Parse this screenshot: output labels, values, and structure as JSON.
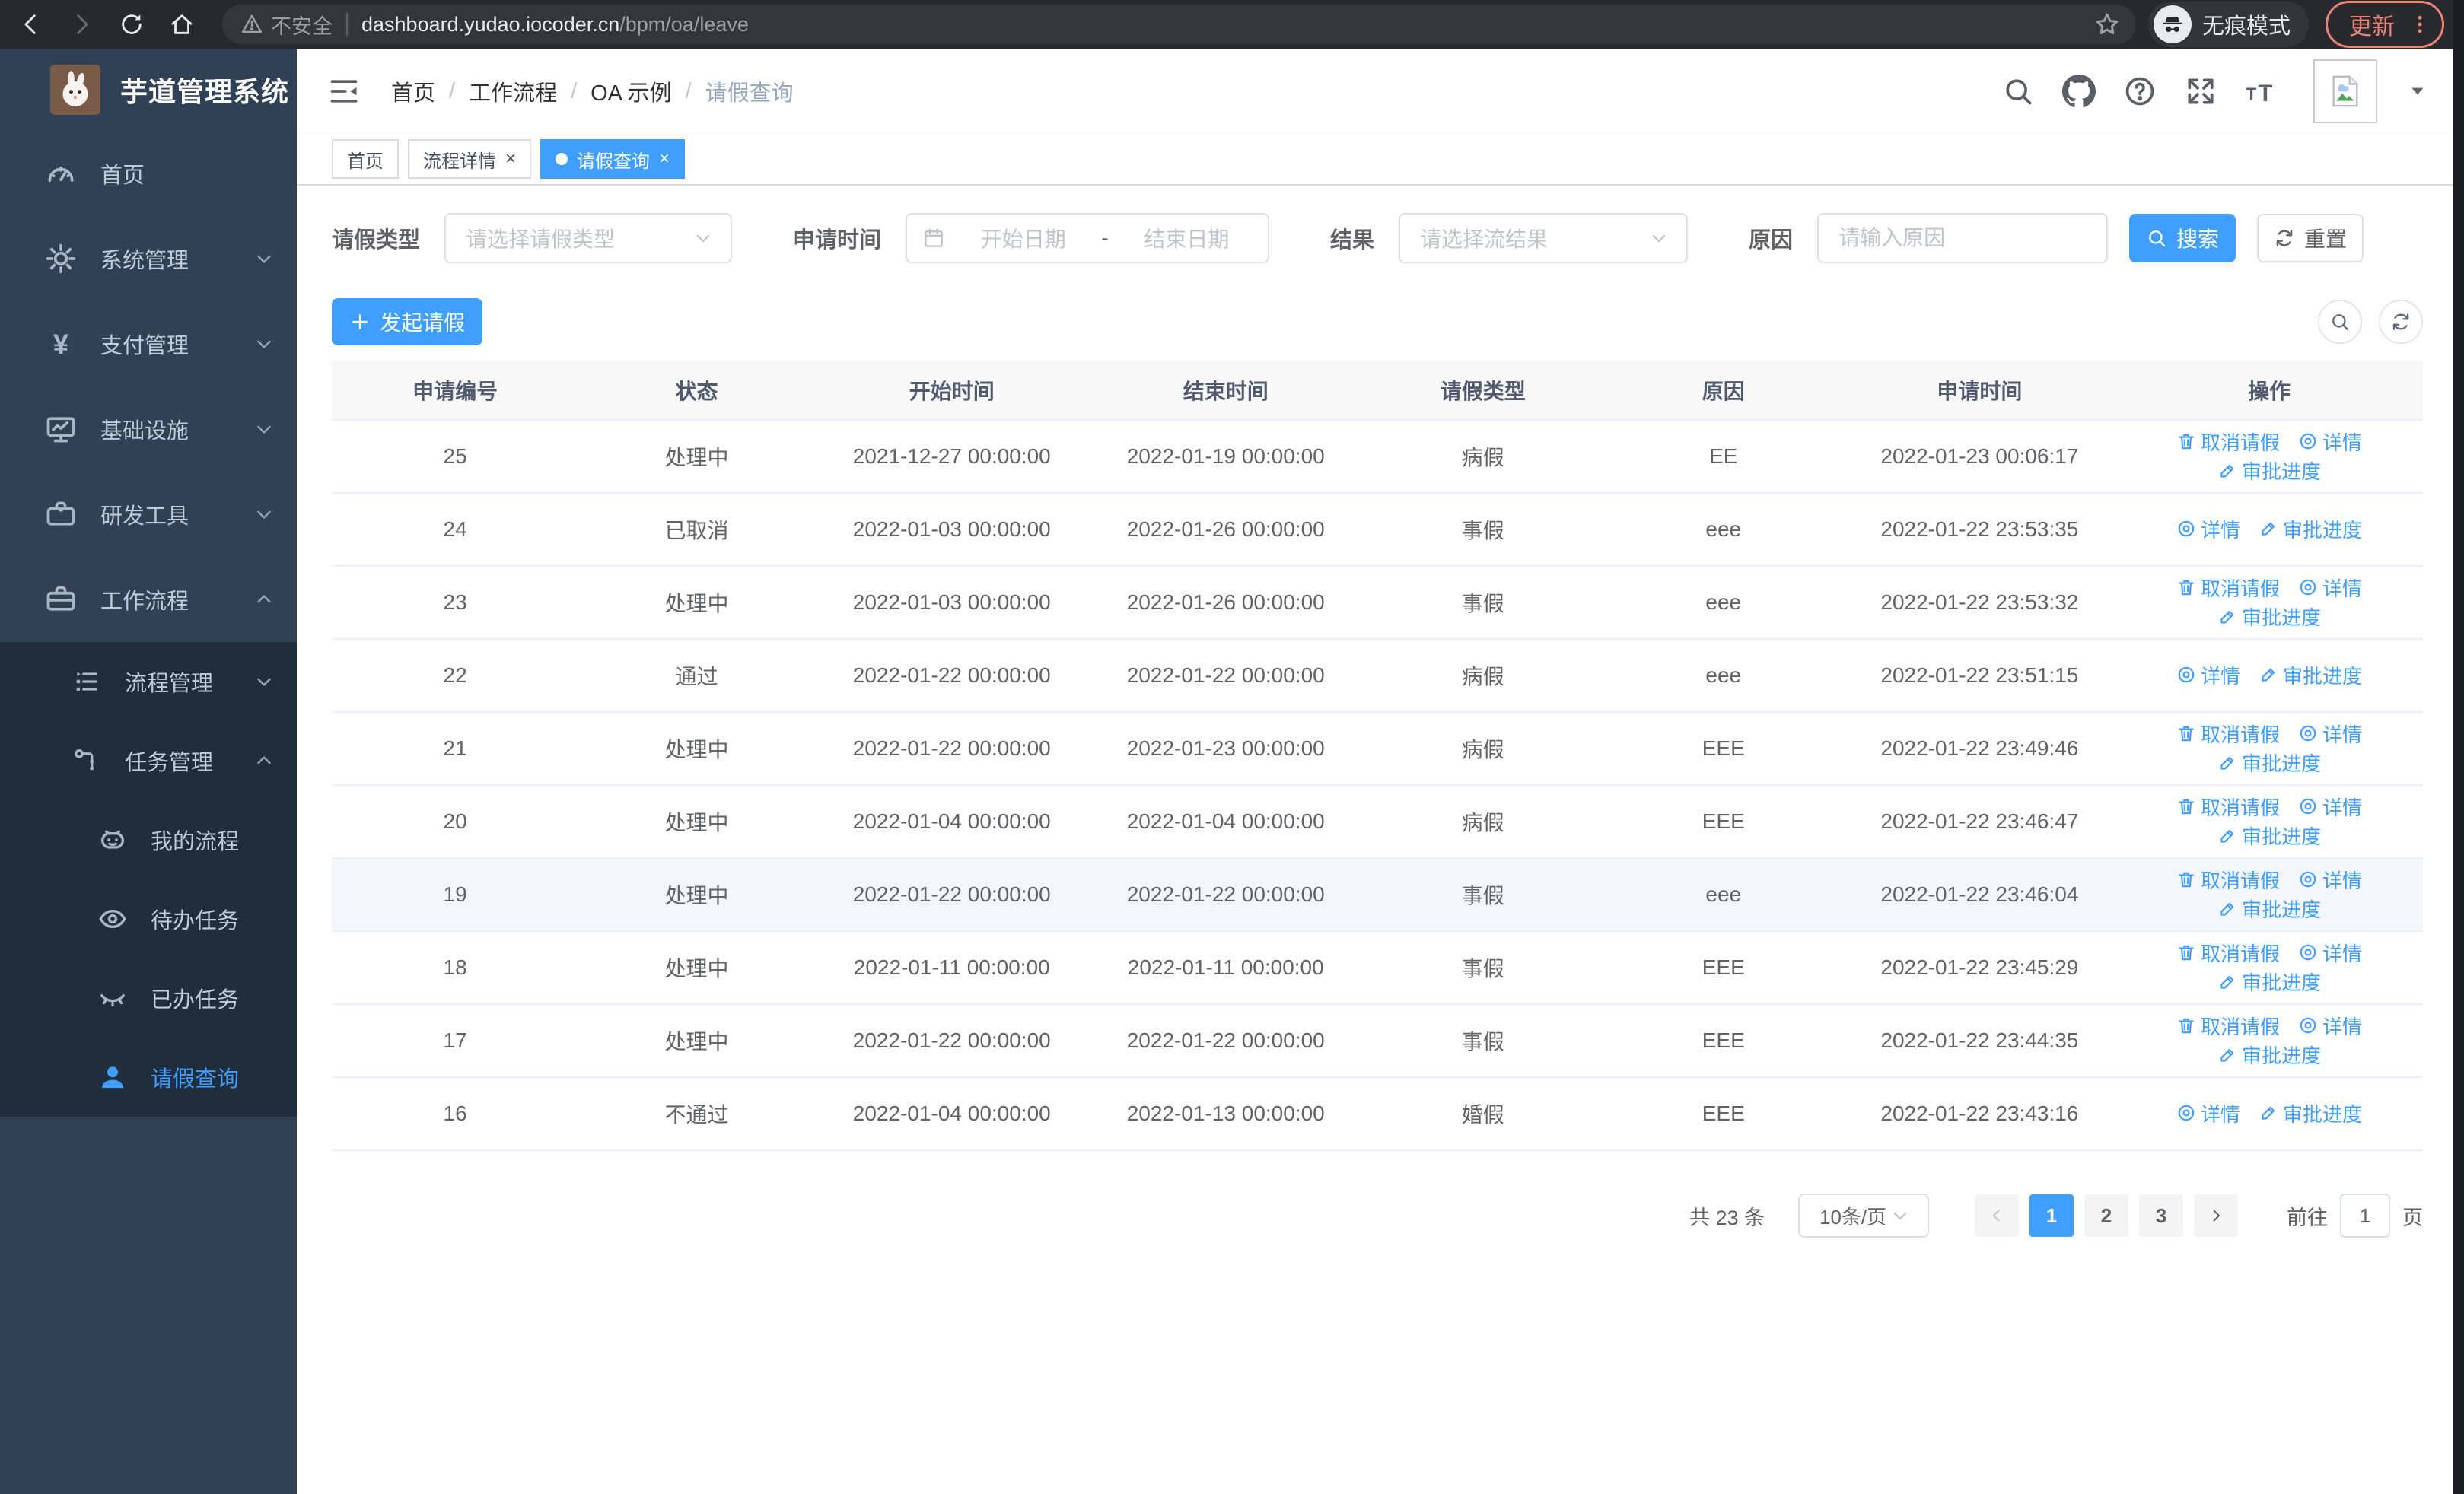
{
  "browser": {
    "nav_icons": [
      "back-icon",
      "forward-icon",
      "reload-icon",
      "home-icon"
    ],
    "security_label": "不安全",
    "url_host": "dashboard.yudao.iocoder.cn",
    "url_path": "/bpm/oa/leave",
    "incognito_label": "无痕模式",
    "update_label": "更新",
    "update_color": "#ee8277"
  },
  "sidebar": {
    "title": "芋道管理系统",
    "menu": [
      {
        "name": "home",
        "label": "首页",
        "icon": "dashboard-icon",
        "level": 0,
        "arrow": null,
        "submenu": false,
        "active": false
      },
      {
        "name": "system",
        "label": "系统管理",
        "icon": "gear-icon",
        "level": 0,
        "arrow": "down",
        "submenu": false,
        "active": false
      },
      {
        "name": "payment",
        "label": "支付管理",
        "icon": "yen-icon",
        "level": 0,
        "arrow": "down",
        "submenu": false,
        "active": false
      },
      {
        "name": "infra",
        "label": "基础设施",
        "icon": "monitor-icon",
        "level": 0,
        "arrow": "down",
        "submenu": false,
        "active": false
      },
      {
        "name": "devtools",
        "label": "研发工具",
        "icon": "toolbox-icon",
        "level": 0,
        "arrow": "down",
        "submenu": false,
        "active": false
      },
      {
        "name": "workflow",
        "label": "工作流程",
        "icon": "briefcase-icon",
        "level": 0,
        "arrow": "up",
        "submenu": false,
        "active": false
      },
      {
        "name": "process-mgmt",
        "label": "流程管理",
        "icon": "list-icon",
        "level": 1,
        "arrow": "down",
        "submenu": true,
        "active": false
      },
      {
        "name": "task-mgmt",
        "label": "任务管理",
        "icon": "sitemap-icon",
        "level": 1,
        "arrow": "up",
        "submenu": true,
        "active": false
      },
      {
        "name": "my-process",
        "label": "我的流程",
        "icon": "robot-icon",
        "level": 2,
        "arrow": null,
        "submenu": true,
        "active": false
      },
      {
        "name": "todo-tasks",
        "label": "待办任务",
        "icon": "eye-icon",
        "level": 2,
        "arrow": null,
        "submenu": true,
        "active": false
      },
      {
        "name": "done-tasks",
        "label": "已办任务",
        "icon": "eye-closed-icon",
        "level": 2,
        "arrow": null,
        "submenu": true,
        "active": false
      },
      {
        "name": "leave-query",
        "label": "请假查询",
        "icon": "user-icon",
        "level": 2,
        "arrow": null,
        "submenu": true,
        "active": true
      }
    ]
  },
  "header": {
    "breadcrumb": [
      {
        "label": "首页",
        "current": false
      },
      {
        "label": "工作流程",
        "current": false
      },
      {
        "label": "OA 示例",
        "current": false
      },
      {
        "label": "请假查询",
        "current": true
      }
    ],
    "tools": [
      "search-icon",
      "github-icon",
      "help-icon",
      "fullscreen-icon",
      "fontsize-icon"
    ],
    "tabs": [
      {
        "name": "home",
        "label": "首页",
        "closable": false,
        "active": false
      },
      {
        "name": "process-detail",
        "label": "流程详情",
        "closable": true,
        "active": false
      },
      {
        "name": "leave-query",
        "label": "请假查询",
        "closable": true,
        "active": true
      }
    ]
  },
  "filters": {
    "leave_type": {
      "label": "请假类型",
      "placeholder": "请选择请假类型"
    },
    "apply_time": {
      "label": "申请时间",
      "start_placeholder": "开始日期",
      "separator": "-",
      "end_placeholder": "结束日期"
    },
    "result": {
      "label": "结果",
      "placeholder": "请选择流结果"
    },
    "reason": {
      "label": "原因",
      "placeholder": "请输入原因"
    },
    "search_label": "搜索",
    "reset_label": "重置"
  },
  "toolbar": {
    "create_label": "发起请假"
  },
  "table": {
    "columns": [
      "申请编号",
      "状态",
      "开始时间",
      "结束时间",
      "请假类型",
      "原因",
      "申请时间",
      "操作"
    ],
    "action_defs": {
      "cancel": {
        "label": "取消请假",
        "icon": "trash-icon"
      },
      "detail": {
        "label": "详情",
        "icon": "view-icon"
      },
      "progress": {
        "label": "审批进度",
        "icon": "edit-icon"
      }
    },
    "rows": [
      {
        "id": "25",
        "status": "处理中",
        "start": "2021-12-27 00:00:00",
        "end": "2022-01-19 00:00:00",
        "type": "病假",
        "reason": "EE",
        "apply_time": "2022-01-23 00:06:17",
        "actions": [
          "cancel",
          "detail",
          "progress"
        ],
        "highlighted": false
      },
      {
        "id": "24",
        "status": "已取消",
        "start": "2022-01-03 00:00:00",
        "end": "2022-01-26 00:00:00",
        "type": "事假",
        "reason": "eee",
        "apply_time": "2022-01-22 23:53:35",
        "actions": [
          "detail",
          "progress"
        ],
        "highlighted": false
      },
      {
        "id": "23",
        "status": "处理中",
        "start": "2022-01-03 00:00:00",
        "end": "2022-01-26 00:00:00",
        "type": "事假",
        "reason": "eee",
        "apply_time": "2022-01-22 23:53:32",
        "actions": [
          "cancel",
          "detail",
          "progress"
        ],
        "highlighted": false
      },
      {
        "id": "22",
        "status": "通过",
        "start": "2022-01-22 00:00:00",
        "end": "2022-01-22 00:00:00",
        "type": "病假",
        "reason": "eee",
        "apply_time": "2022-01-22 23:51:15",
        "actions": [
          "detail",
          "progress"
        ],
        "highlighted": false
      },
      {
        "id": "21",
        "status": "处理中",
        "start": "2022-01-22 00:00:00",
        "end": "2022-01-23 00:00:00",
        "type": "病假",
        "reason": "EEE",
        "apply_time": "2022-01-22 23:49:46",
        "actions": [
          "cancel",
          "detail",
          "progress"
        ],
        "highlighted": false
      },
      {
        "id": "20",
        "status": "处理中",
        "start": "2022-01-04 00:00:00",
        "end": "2022-01-04 00:00:00",
        "type": "病假",
        "reason": "EEE",
        "apply_time": "2022-01-22 23:46:47",
        "actions": [
          "cancel",
          "detail",
          "progress"
        ],
        "highlighted": false
      },
      {
        "id": "19",
        "status": "处理中",
        "start": "2022-01-22 00:00:00",
        "end": "2022-01-22 00:00:00",
        "type": "事假",
        "reason": "eee",
        "apply_time": "2022-01-22 23:46:04",
        "actions": [
          "cancel",
          "detail",
          "progress"
        ],
        "highlighted": true
      },
      {
        "id": "18",
        "status": "处理中",
        "start": "2022-01-11 00:00:00",
        "end": "2022-01-11 00:00:00",
        "type": "事假",
        "reason": "EEE",
        "apply_time": "2022-01-22 23:45:29",
        "actions": [
          "cancel",
          "detail",
          "progress"
        ],
        "highlighted": false
      },
      {
        "id": "17",
        "status": "处理中",
        "start": "2022-01-22 00:00:00",
        "end": "2022-01-22 00:00:00",
        "type": "事假",
        "reason": "EEE",
        "apply_time": "2022-01-22 23:44:35",
        "actions": [
          "cancel",
          "detail",
          "progress"
        ],
        "highlighted": false
      },
      {
        "id": "16",
        "status": "不通过",
        "start": "2022-01-04 00:00:00",
        "end": "2022-01-13 00:00:00",
        "type": "婚假",
        "reason": "EEE",
        "apply_time": "2022-01-22 23:43:16",
        "actions": [
          "detail",
          "progress"
        ],
        "highlighted": false
      }
    ]
  },
  "pagination": {
    "total_label": "共 23 条",
    "page_size_label": "10条/页",
    "pages": [
      "1",
      "2",
      "3"
    ],
    "active_page": "1",
    "goto_label": "前往",
    "goto_value": "1",
    "page_unit": "页"
  },
  "colors": {
    "accent": "#409eff",
    "sidebar_bg": "#304156",
    "submenu_bg": "#1f2d3d"
  }
}
